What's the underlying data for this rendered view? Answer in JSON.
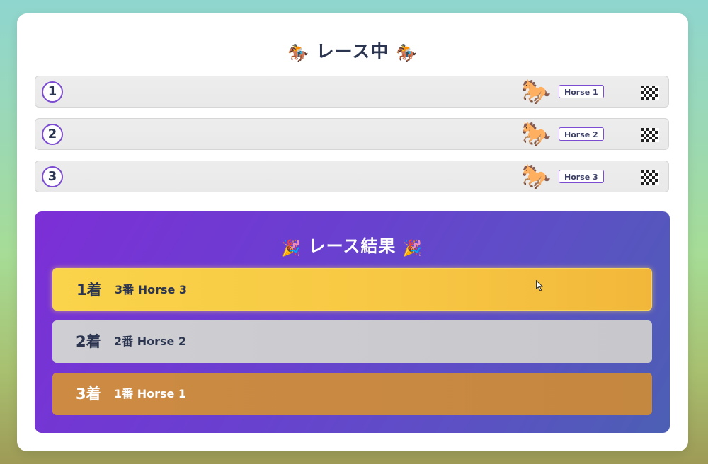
{
  "race": {
    "title": "レース中",
    "title_icon": "horse-racing-emoji",
    "lanes": [
      {
        "number": "1",
        "horse_label": "Horse 1"
      },
      {
        "number": "2",
        "horse_label": "Horse 2"
      },
      {
        "number": "3",
        "horse_label": "Horse 3"
      }
    ],
    "horse_icon": "horse-emoji",
    "goal_icon": "checkered-flag-emoji"
  },
  "results": {
    "title": "レース結果",
    "title_icon": "party-popper-emoji",
    "places": [
      {
        "rank": "1着",
        "entry": "3番 Horse 3",
        "color": "#f7c743"
      },
      {
        "rank": "2着",
        "entry": "2番 Horse 2",
        "color": "#c8c8cc"
      },
      {
        "rank": "3着",
        "entry": "1番 Horse 1",
        "color": "#c58841"
      }
    ]
  },
  "colors": {
    "accent": "#7b4bd1",
    "results_panel": "#6a3fd0",
    "text_dark": "#2b3550"
  }
}
